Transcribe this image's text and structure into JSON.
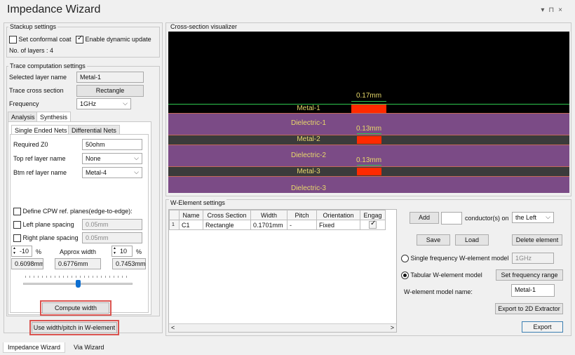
{
  "window": {
    "title": "Impedance Wizard",
    "controls": "▾ ⊓ ×"
  },
  "stackup": {
    "group_label": "Stackup settings",
    "conformal_coat_label": "Set conformal coat",
    "conformal_coat_checked": false,
    "dynamic_update_label": "Enable dynamic update",
    "dynamic_update_checked": true,
    "num_layers_label": "No. of layers :",
    "num_layers_value": "4"
  },
  "trace": {
    "group_label": "Trace computation settings",
    "selected_layer_label": "Selected layer name",
    "selected_layer_value": "Metal-1",
    "cross_section_label": "Trace cross section",
    "cross_section_value": "Rectangle",
    "frequency_label": "Frequency",
    "frequency_value": "1GHz"
  },
  "tabs": {
    "analysis": "Analysis",
    "synthesis": "Synthesis"
  },
  "subtabs": {
    "single": "Single Ended Nets",
    "differential": "Differential Nets"
  },
  "synthesis": {
    "required_z0_label": "Required Z0",
    "required_z0_value": "50ohm",
    "top_ref_label": "Top ref layer name",
    "top_ref_value": "None",
    "btm_ref_label": "Btm ref layer name",
    "btm_ref_value": "Metal-4",
    "cpw_label": "Define CPW ref. planes(edge-to-edge):",
    "left_plane_label": "Left plane spacing",
    "left_plane_value": "0.05mm",
    "right_plane_label": "Right plane spacing",
    "right_plane_value": "0.05mm",
    "minus_pct": "-10",
    "plus_pct": "10",
    "pct_symbol": "%",
    "approx_width_label": "Approx width",
    "min_width": "0.6098mm",
    "approx_width": "0.6776mm",
    "max_width": "0.7453mm",
    "slider_fraction": 0.5,
    "compute_button": "Compute width",
    "use_width_button": "Use width/pitch in W-element"
  },
  "visualizer": {
    "group_label": "Cross-section visualizer",
    "layers": [
      {
        "name": "Metal-1",
        "kind": "metal"
      },
      {
        "name": "Dielectric-1",
        "kind": "dielectric"
      },
      {
        "name": "Metal-2",
        "kind": "metal"
      },
      {
        "name": "Dielectric-2",
        "kind": "dielectric"
      },
      {
        "name": "Metal-3",
        "kind": "metal"
      },
      {
        "name": "Dielectric-3",
        "kind": "dielectric"
      }
    ],
    "dims": [
      "0.17mm",
      "0.13mm",
      "0.13mm"
    ],
    "colors": {
      "dielectric": "#7b4b86",
      "trace": "#ff2a00",
      "label": "#e8d96a",
      "ground_line": "#2ec84f"
    }
  },
  "welement": {
    "group_label": "W-Element settings",
    "columns": [
      "Name",
      "Cross Section",
      "Width",
      "Pitch",
      "Orientation",
      "Engag"
    ],
    "rows": [
      {
        "index": "1",
        "name": "C1",
        "cross_section": "Rectangle",
        "width": "0.1701mm",
        "pitch": "-",
        "orientation": "Fixed",
        "engaged": true
      }
    ],
    "add_button": "Add",
    "add_count": "",
    "conductors_label": "conductor(s) on",
    "side_value": "the Left",
    "save_button": "Save",
    "load_button": "Load",
    "delete_button": "Delete element",
    "single_freq_label": "Single frequency W-element model",
    "single_freq_value": "1GHz",
    "tabular_label": "Tabular W-element model",
    "set_freq_button": "Set frequency range",
    "model_name_label": "W-element model name:",
    "model_name_value": "Metal-1",
    "export_2d_button": "Export to 2D Extractor",
    "export_button": "Export"
  },
  "bottom_tabs": [
    "Impedance Wizard",
    "Via Wizard"
  ],
  "icons": {
    "spin_up": "▲",
    "spin_down": "▼",
    "chevron": "⌵",
    "scroll_left": "<",
    "scroll_right": ">"
  }
}
